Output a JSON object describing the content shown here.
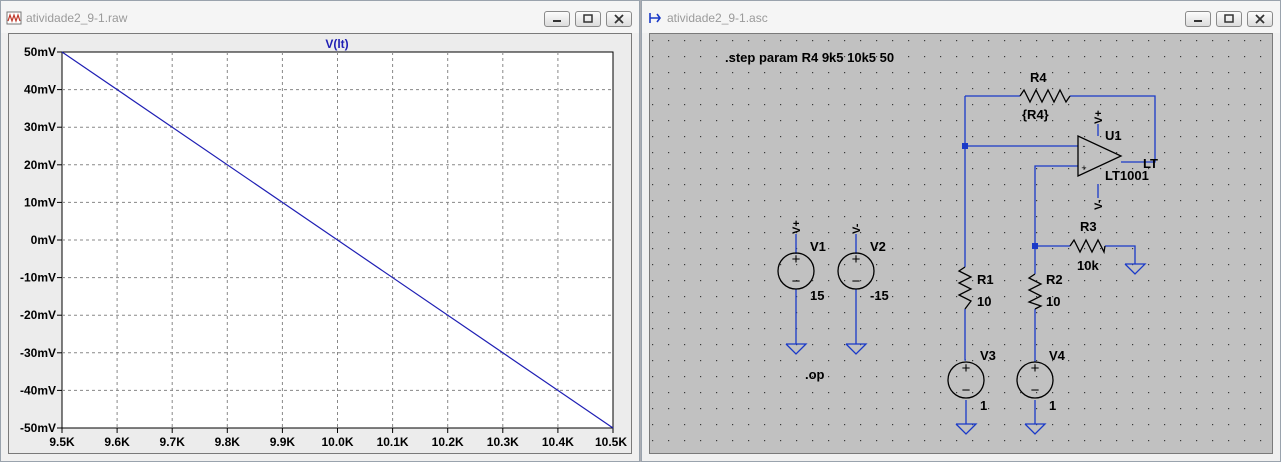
{
  "plot_window": {
    "title": "atividade2_9-1.raw",
    "trace_label": "V(lt)",
    "trace_color": "#1f1fb4"
  },
  "schematic_window": {
    "title": "atividade2_9-1.asc",
    "wire_color": "#1a3ac8",
    "directives": {
      "step": ".step param R4 9k5 10k5 50",
      "op": ".op"
    },
    "components": {
      "R4": {
        "name": "R4",
        "value": "{R4}"
      },
      "R1": {
        "name": "R1",
        "value": "10"
      },
      "R2": {
        "name": "R2",
        "value": "10"
      },
      "R3": {
        "name": "R3",
        "value": "10k"
      },
      "U1": {
        "name": "U1",
        "model": "LT1001",
        "plus": "+",
        "minus": "-"
      },
      "V1": {
        "name": "V1",
        "value": "15"
      },
      "V2": {
        "name": "V2",
        "value": "-15"
      },
      "V3": {
        "name": "V3",
        "value": "1"
      },
      "V4": {
        "name": "V4",
        "value": "1"
      }
    },
    "net_labels": {
      "vplus": "V+",
      "vminus": "V-",
      "u1_vplus": "V+",
      "u1_vminus": "V-",
      "output": "LT"
    }
  },
  "window_buttons": {
    "minimize": "minimize-icon",
    "maximize": "maximize-icon",
    "close": "close-icon"
  },
  "chart_data": {
    "type": "line",
    "title": "V(lt)",
    "xlabel": "",
    "ylabel": "",
    "x_ticks": [
      "9.5K",
      "9.6K",
      "9.7K",
      "9.8K",
      "9.9K",
      "10.0K",
      "10.1K",
      "10.2K",
      "10.3K",
      "10.4K",
      "10.5K"
    ],
    "y_ticks": [
      "50mV",
      "40mV",
      "30mV",
      "20mV",
      "10mV",
      "0mV",
      "-10mV",
      "-20mV",
      "-30mV",
      "-40mV",
      "-50mV"
    ],
    "xlim": [
      9500,
      10500
    ],
    "ylim": [
      -50,
      50
    ],
    "grid": true,
    "series": [
      {
        "name": "V(lt)",
        "x": [
          9500,
          10500
        ],
        "y": [
          50,
          -50
        ]
      }
    ]
  }
}
